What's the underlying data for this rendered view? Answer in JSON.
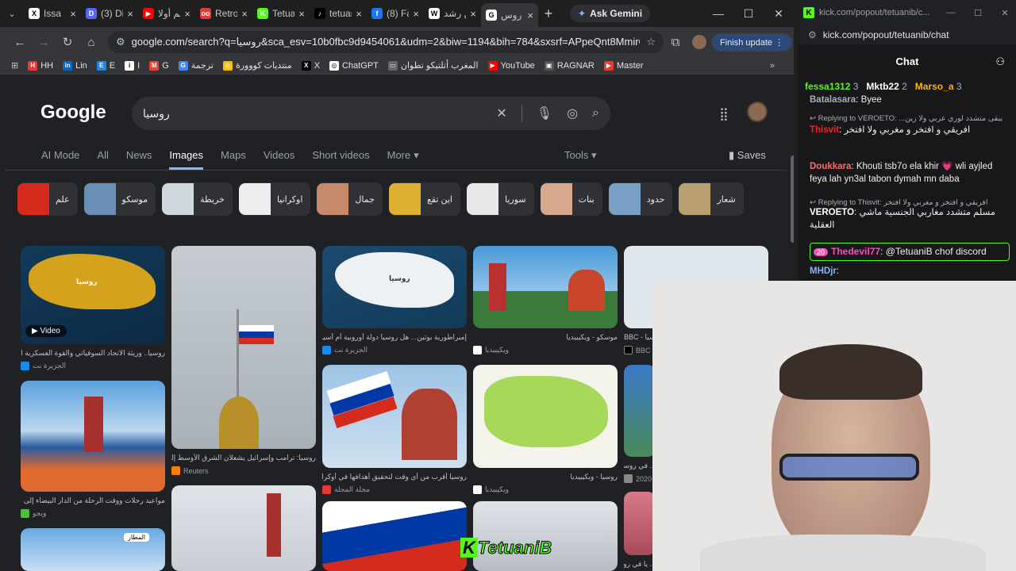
{
  "tabs": [
    {
      "icon": "x-logo-icon",
      "title": "Issa",
      "fav_color": "#ffffff",
      "fav_text": "X"
    },
    {
      "icon": "discord-icon",
      "title": "(3) Disc",
      "fav_color": "#5865f2",
      "fav_text": "D"
    },
    {
      "icon": "youtube-icon",
      "title": "فيلم أولا",
      "fav_color": "#ff0000",
      "fav_text": "▶"
    },
    {
      "icon": "retrogames-icon",
      "title": "RetroGa",
      "fav_color": "#e53935",
      "fav_text": "oo"
    },
    {
      "icon": "kick-icon",
      "title": "Tetuani",
      "fav_color": "#53fc18",
      "fav_text": "K"
    },
    {
      "icon": "tiktok-icon",
      "title": "tetuani",
      "fav_color": "#000000",
      "fav_text": "♪"
    },
    {
      "icon": "facebook-icon",
      "title": "(8) Face",
      "fav_color": "#1877f2",
      "fav_text": "f"
    },
    {
      "icon": "wikipedia-icon",
      "title": "ابن رشد",
      "fav_color": "#ffffff",
      "fav_text": "W"
    },
    {
      "icon": "google-icon",
      "title": "روس",
      "fav_color": "#ffffff",
      "fav_text": "G",
      "active": true
    }
  ],
  "gemini_label": "Ask Gemini",
  "url": "google.com/search?q=روسيا&sca_esv=10b0fbc9d9454061&udm=2&biw=1194&bih=784&sxsrf=APpeQnt8MmirG_o...",
  "finish_update": "Finish update",
  "bookmarks": [
    {
      "label": "HH",
      "color": "#e53935"
    },
    {
      "label": "Lin",
      "color": "#0a66c2",
      "text": "in"
    },
    {
      "label": "E",
      "color": "#1e88e5"
    },
    {
      "label": "I",
      "color": "#ffffff",
      "text": "i"
    },
    {
      "label": "G",
      "color": "#ea4335",
      "text": "M"
    },
    {
      "label": "ترجمة",
      "color": "#4285f4",
      "text": "G"
    },
    {
      "label": "منتديات كووورة",
      "color": "#fbbc04",
      "text": "◎"
    },
    {
      "label": "X",
      "color": "#000000",
      "text": "X"
    },
    {
      "label": "ChatGPT",
      "color": "#ffffff",
      "text": "◎"
    },
    {
      "label": "المغرب أتلتيكو تطوان",
      "color": "#666666",
      "text": "▭"
    },
    {
      "label": "YouTube",
      "color": "#ff0000",
      "text": "▶"
    },
    {
      "label": "RAGNAR",
      "color": "#555555",
      "text": "▣"
    },
    {
      "label": "Master",
      "color": "#e53935",
      "text": "▶"
    }
  ],
  "google": {
    "logo": "Google",
    "query": "روسيا",
    "tabs": [
      "AI Mode",
      "All",
      "News",
      "Images",
      "Maps",
      "Videos",
      "Short videos",
      "More"
    ],
    "active_tab": "Images",
    "tools": "Tools",
    "saves": "Saves",
    "chips": [
      {
        "label": "علم",
        "color": "#d52b1e"
      },
      {
        "label": "موسكو",
        "color": "#6a8fb5"
      },
      {
        "label": "خريطة",
        "color": "#cfd8dc"
      },
      {
        "label": "اوكرانيا",
        "color": "#eeeeee"
      },
      {
        "label": "جمال",
        "color": "#c48a6a"
      },
      {
        "label": "اين تقع",
        "color": "#e0b030"
      },
      {
        "label": "سوريا",
        "color": "#e8e8e8"
      },
      {
        "label": "بنات",
        "color": "#d7a98c"
      },
      {
        "label": "حدود",
        "color": "#7aa0c8"
      },
      {
        "label": "شعار",
        "color": "#b8a070"
      }
    ],
    "results": [
      {
        "caption": "روسيا.. وريثة الاتحاد السوفياتي والقوة العسكرية الثانية",
        "source": "الجزيرة نت",
        "video": "Video"
      },
      {
        "caption": "روسيا: ترامب وإسرائيل يشعلان الشرق الأوسط إلى",
        "source": "Reuters"
      },
      {
        "caption": "إمبراطورية بوتين... هل روسيا دولة أوروبية أم آسيو...",
        "source": "الجزيرة نت"
      },
      {
        "caption": "موسكو - ويكيبيديا",
        "source": "ويكيبيديا"
      },
      {
        "caption": "BBC - روسيا",
        "source": "BBC"
      },
      {
        "caption": "مواعيد رحلات ووقت الرحلة من الدار البيضاء إلى",
        "source": "ويجو"
      },
      {
        "caption": "روسيا أقرب من أي وقت لتحقيق أهدافها في أوكرانيا",
        "source": "مجلة المجلة"
      },
      {
        "caption": "روسيا - ويكيبيديا",
        "source": "ويكيبيديا"
      },
      {
        "caption": "... في روسيا",
        "source": "2020"
      },
      {
        "caption": "... يا في روسيا",
        "source": ""
      },
      {
        "badge": "المطار"
      }
    ],
    "map_label_1": "روسيا",
    "map_label_2": "روسيا"
  },
  "chat": {
    "window_title": "kick.com/popout/tetuanib/c...",
    "url": "kick.com/popout/tetuanib/chat",
    "header": "Chat",
    "pinned": [
      {
        "name": "fessa1312",
        "count": "3",
        "color": "#53fc18"
      },
      {
        "name": "Mktb22",
        "count": "2",
        "color": "#ffffff"
      },
      {
        "name": "Marso_a",
        "count": "3",
        "color": "#ffb300"
      }
    ],
    "messages": [
      {
        "user": "Batalasara",
        "text": "Byee",
        "color": "#adadb8"
      },
      {
        "reply": "Replying to VEROETO: ...يبقى متشدد لوري عربي ولا زين"
      },
      {
        "user": "Thisvit",
        "text": "افريقي و افتخر و مغربي ولا افتخر",
        "color": "#ff1f1f"
      },
      {
        "user": "Doukkara",
        "text": "Khouti tsb7o ela khir 💗 wli ayjled feya lah yn3al tabon dymah mn daba",
        "color": "#ff6a6a"
      },
      {
        "reply": "Replying to Thisvit: افريقي و افتخر و مغربي ولا افتخر"
      },
      {
        "user": "VEROETO",
        "text": "مسلم متشدد مغاربي الجنسية ماشي العقلية",
        "color": "#ffffff"
      },
      {
        "user": "Thedevil77",
        "text": "@TetuaniB chof discord",
        "color": "#ff4dbb",
        "badge": "20"
      },
      {
        "user": "MHDjr",
        "text": "",
        "color": "#8ab4f8"
      }
    ]
  },
  "watermark": "TetuaniB"
}
